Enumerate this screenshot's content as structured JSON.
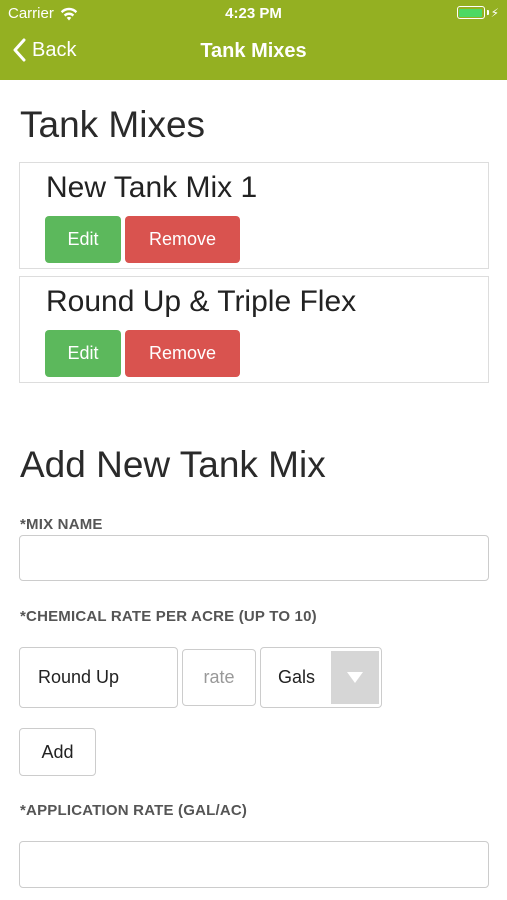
{
  "status_bar": {
    "carrier": "Carrier",
    "time": "4:23 PM"
  },
  "nav": {
    "back_label": "Back",
    "title": "Tank Mixes"
  },
  "tank_mixes": {
    "heading": "Tank Mixes",
    "items": [
      {
        "name": "New Tank Mix 1",
        "edit_label": "Edit",
        "remove_label": "Remove"
      },
      {
        "name": "Round Up & Triple Flex",
        "edit_label": "Edit",
        "remove_label": "Remove"
      }
    ]
  },
  "add_form": {
    "heading": "Add New Tank Mix",
    "mix_name_label": "*MIX NAME",
    "mix_name_value": "",
    "chemical_rate_label": "*CHEMICAL RATE PER ACRE (UP TO 10)",
    "chemical_name": "Round Up",
    "rate_placeholder": "rate",
    "unit_selected": "Gals",
    "add_label": "Add",
    "application_rate_label": "*APPLICATION RATE (GAL/AC)",
    "application_rate_value": ""
  },
  "colors": {
    "header": "#94b022",
    "edit": "#5cb85c",
    "remove": "#d9534f",
    "battery": "#4cd964"
  },
  "icons": [
    "wifi-icon",
    "battery-icon",
    "charging-bolt-icon",
    "back-chevron-icon",
    "dropdown-arrow-icon"
  ]
}
